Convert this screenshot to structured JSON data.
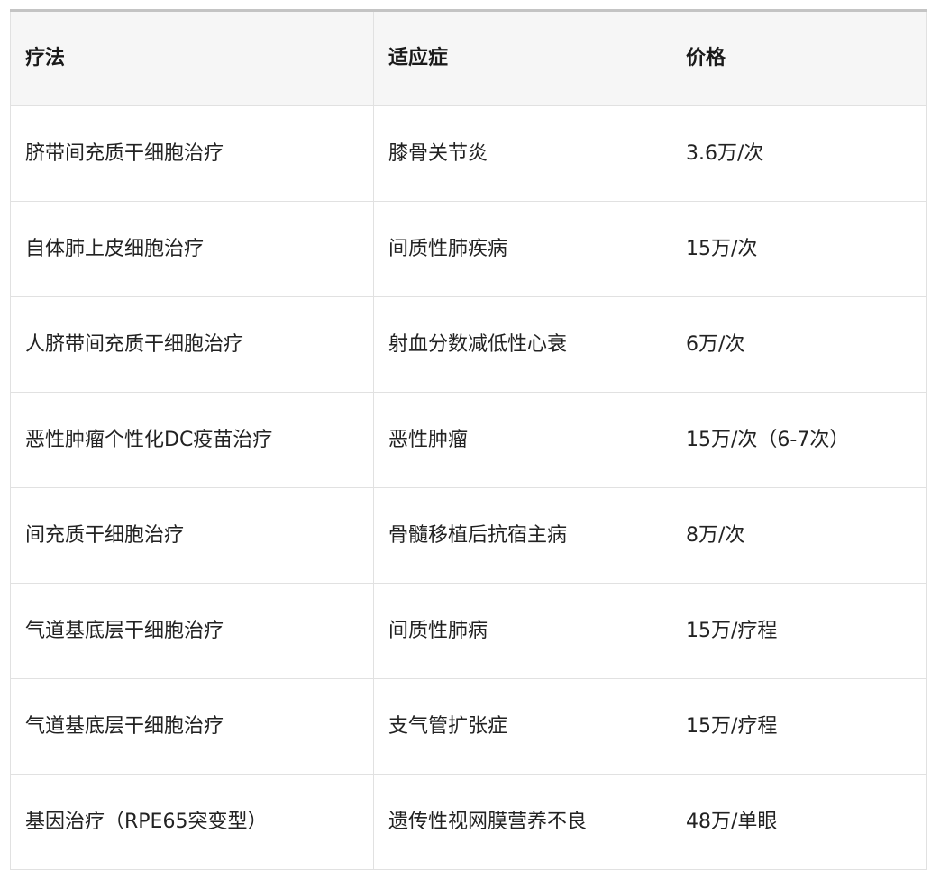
{
  "table": {
    "headers": [
      "疗法",
      "适应症",
      "价格"
    ],
    "rows": [
      [
        "脐带间充质干细胞治疗",
        "膝骨关节炎",
        "3.6万/次"
      ],
      [
        "自体肺上皮细胞治疗",
        "间质性肺疾病",
        "15万/次"
      ],
      [
        "人脐带间充质干细胞治疗",
        "射血分数减低性心衰",
        "6万/次"
      ],
      [
        "恶性肿瘤个性化DC疫苗治疗",
        "恶性肿瘤",
        "15万/次（6-7次）"
      ],
      [
        "间充质干细胞治疗",
        "骨髓移植后抗宿主病",
        "8万/次"
      ],
      [
        "气道基底层干细胞治疗",
        "间质性肺病",
        "15万/疗程"
      ],
      [
        "气道基底层干细胞治疗",
        "支气管扩张症",
        "15万/疗程"
      ],
      [
        "基因治疗（RPE65突变型）",
        "遗传性视网膜营养不良",
        "48万/单眼"
      ]
    ]
  }
}
